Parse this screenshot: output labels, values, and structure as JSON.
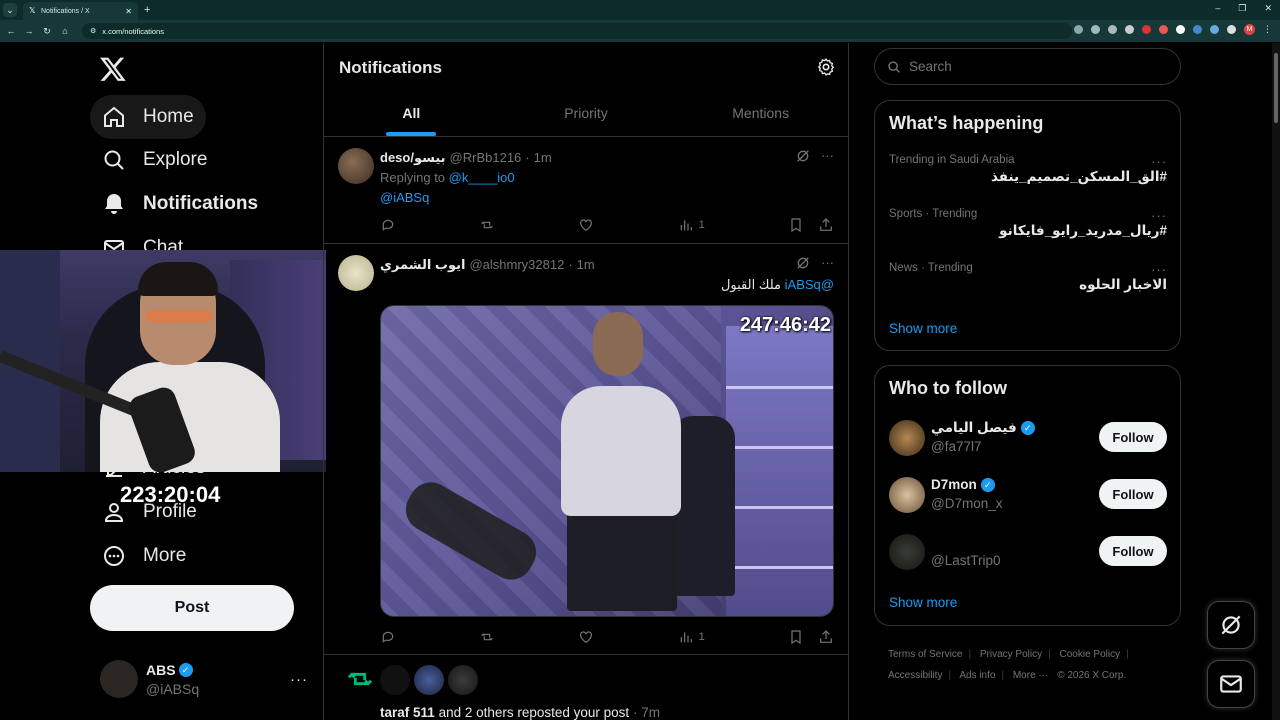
{
  "browser": {
    "tab_title": "Notifications / X",
    "url": "x.com/notifications"
  },
  "sidebar": {
    "items": [
      {
        "label": "Home",
        "icon": "home-icon"
      },
      {
        "label": "Explore",
        "icon": "search-icon"
      },
      {
        "label": "Notifications",
        "icon": "bell-icon"
      },
      {
        "label": "Chat",
        "icon": "mail-icon"
      },
      {
        "label": "Articles",
        "icon": "articles-icon"
      },
      {
        "label": "Profile",
        "icon": "person-icon"
      },
      {
        "label": "More",
        "icon": "more-circle-icon"
      }
    ],
    "post_label": "Post",
    "account": {
      "name": "ABS",
      "handle": "@iABSq"
    }
  },
  "overlay": {
    "webcam_timer": "223:20:04",
    "media_timer": "247:46:42"
  },
  "main": {
    "title": "Notifications",
    "tabs": [
      "All",
      "Priority",
      "Mentions"
    ],
    "posts": [
      {
        "name": "deso/بيسو",
        "handle": "@RrBb1216",
        "time": "1m",
        "replying_prefix": "Replying to",
        "replying_to": "@k____io0",
        "mention": "@iABSq",
        "views": "1"
      },
      {
        "name": "ايوب الشمري",
        "handle": "@alshmry32812",
        "time": "1m",
        "text": "ملك القبول",
        "mention": "@iABSq",
        "views": "1"
      }
    ],
    "repost_notification": {
      "actor": "taraf 511",
      "rest": "and 2 others reposted your post",
      "time": "7m"
    }
  },
  "right": {
    "search_placeholder": "Search",
    "happening": {
      "title": "What’s happening",
      "trends": [
        {
          "context": "Trending in Saudi Arabia",
          "title": "#الق_المسكن_تصميم_ينفذ"
        },
        {
          "context": "Sports · Trending",
          "title": "#ريال_مدريد_رايو_فايكانو"
        },
        {
          "context": "News · Trending",
          "title": "الاخبار الحلوه"
        }
      ],
      "show_more": "Show more"
    },
    "who_to_follow": {
      "title": "Who to follow",
      "accounts": [
        {
          "name": "فيصل اليامي",
          "handle": "@fa77l7",
          "verified": true
        },
        {
          "name": "D7mon",
          "handle": "@D7mon_x",
          "verified": true
        },
        {
          "name": "",
          "handle": "@LastTrip0",
          "verified": false
        }
      ],
      "follow_label": "Follow",
      "show_more": "Show more"
    },
    "footer": [
      "Terms of Service",
      "Privacy Policy",
      "Cookie Policy",
      "Accessibility",
      "Ads info",
      "More ···",
      "© 2026 X Corp."
    ]
  },
  "colors": {
    "accent": "#1d9bf0",
    "background": "#000000",
    "border": "#2f3336",
    "muted_text": "#71767b",
    "repost_green": "#00ba7c"
  }
}
